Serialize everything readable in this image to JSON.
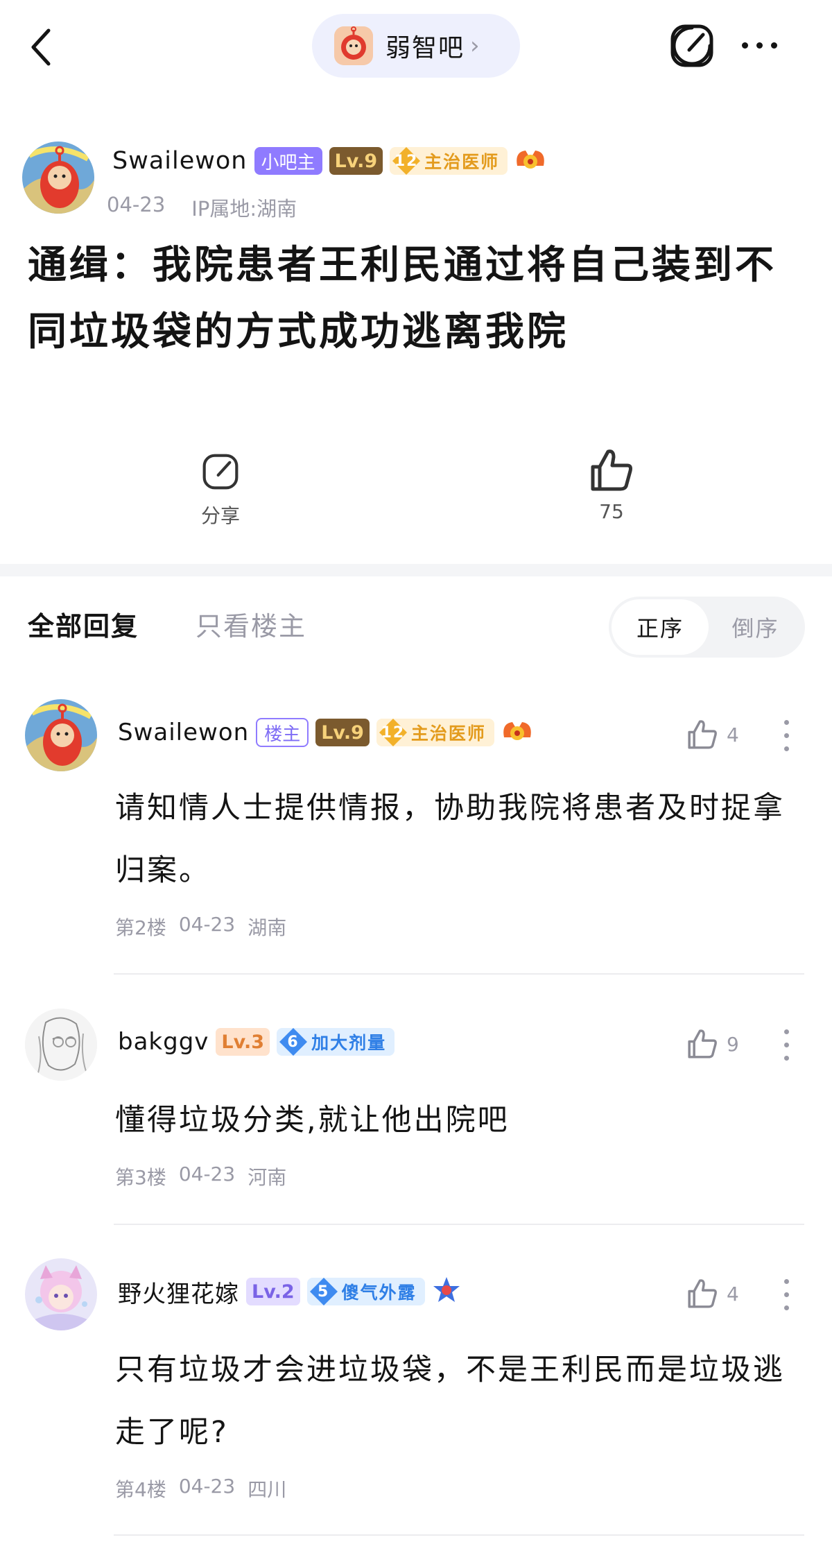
{
  "topbar": {
    "forum_name": "弱智吧",
    "chevron": "›"
  },
  "post": {
    "author": "Swailewon",
    "owner_badge": "小吧主",
    "level": "Lv.9",
    "honor_rank": "12",
    "honor_title": "主治医师",
    "date": "04-23",
    "ip": "IP属地:湖南",
    "title": "通缉：我院患者王利民通过将自己装到不同垃圾袋的方式成功逃离我院",
    "share_label": "分享",
    "like_count": "75"
  },
  "tabs": {
    "all_replies": "全部回复",
    "op_only": "只看楼主",
    "sort_asc": "正序",
    "sort_desc": "倒序"
  },
  "replies": [
    {
      "author": "Swailewon",
      "tag": "楼主",
      "level": "Lv.9",
      "honor_rank": "12",
      "honor_title": "主治医师",
      "likes": "4",
      "text": "请知情人士提供情报，协助我院将患者及时捉拿归案。",
      "floor": "第2楼",
      "date": "04-23",
      "location": "湖南"
    },
    {
      "author": "bakggv",
      "level": "Lv.3",
      "honor_rank": "6",
      "honor_title": "加大剂量",
      "likes": "9",
      "text": "懂得垃圾分类,就让他出院吧",
      "floor": "第3楼",
      "date": "04-23",
      "location": "河南"
    },
    {
      "author": "野火狸花嫁",
      "level": "Lv.2",
      "honor_rank": "5",
      "honor_title": "傻气外露",
      "likes": "4",
      "text": "只有垃圾才会进垃圾袋，不是王利民而是垃圾逃走了呢?",
      "floor": "第4楼",
      "date": "04-23",
      "location": "四川"
    }
  ],
  "icons": [
    "back-arrow-icon",
    "share-icon",
    "more-icon",
    "like-icon",
    "thumb-up-icon",
    "teletubby-avatar-icon",
    "achievement-icon",
    "star-badge-icon"
  ],
  "colors": {
    "accent": "#8f7bff",
    "gold": "#e39b1d",
    "blue": "#2f7fe6",
    "muted": "#9a9aa6"
  }
}
